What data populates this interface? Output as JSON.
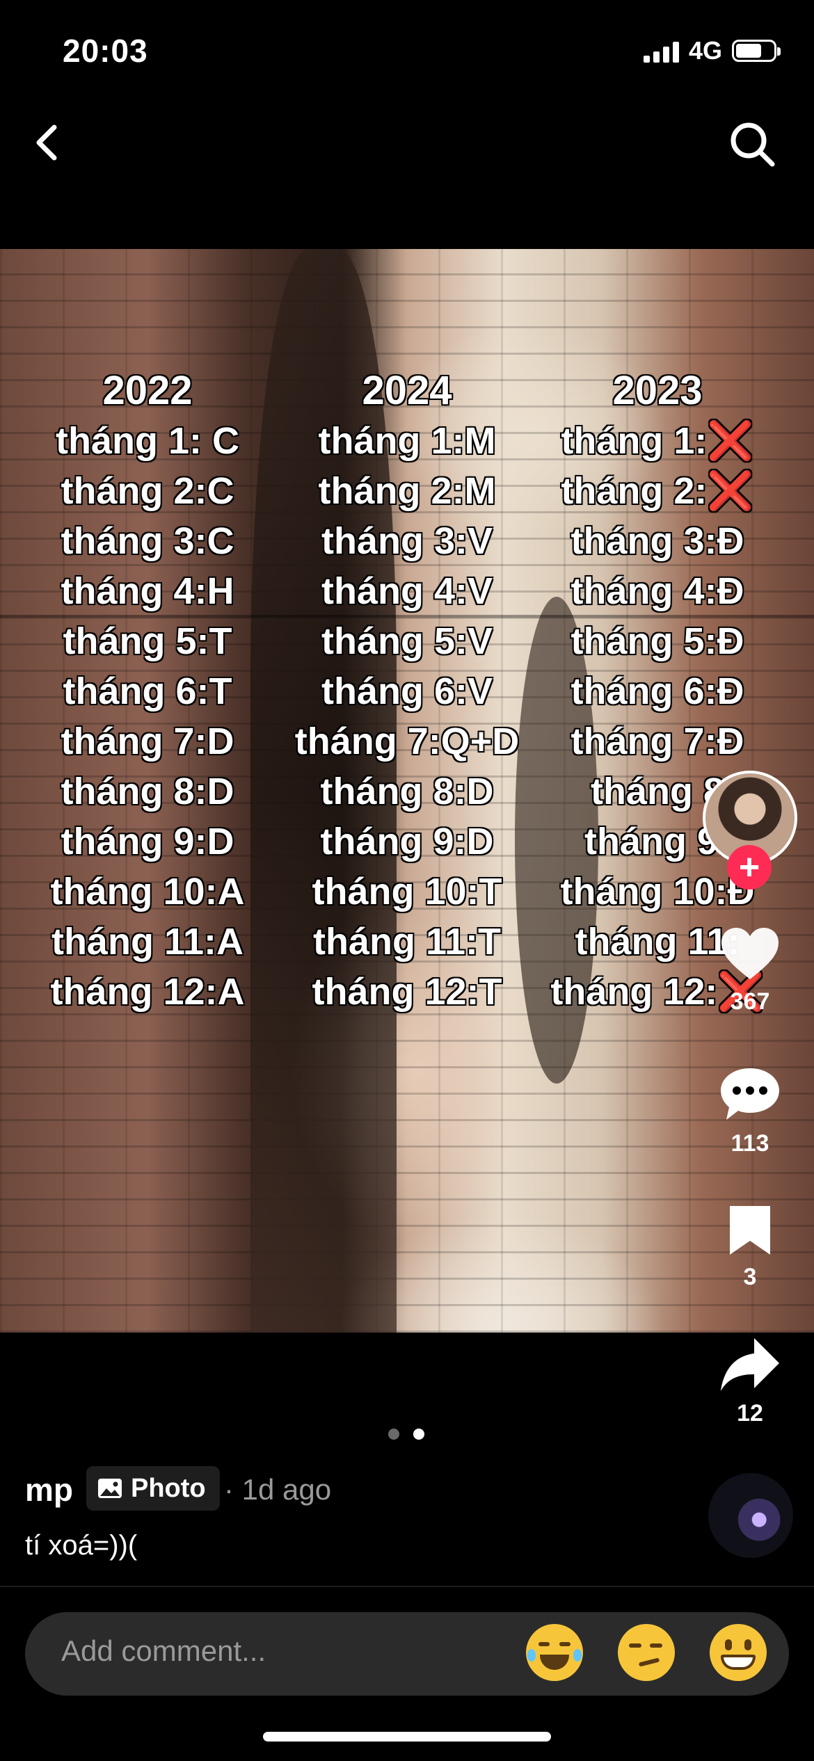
{
  "status_bar": {
    "time": "20:03",
    "network": "4G",
    "battery_level": 0.7
  },
  "nav": {
    "back_icon": "chevron-left-icon",
    "search_icon": "search-icon"
  },
  "photo": {
    "columns": [
      {
        "year": "2022",
        "months": [
          "tháng 1: C",
          "tháng 2:C",
          "tháng 3:C",
          "tháng 4:H",
          "tháng 5:T",
          "tháng 6:T",
          "tháng 7:D",
          "tháng 8:D",
          "tháng 9:D",
          "tháng 10:A",
          "tháng 11:A",
          "tháng 12:A"
        ]
      },
      {
        "year": "2024",
        "months": [
          "tháng 1:M",
          "tháng 2:M",
          "tháng 3:V",
          "tháng 4:V",
          "tháng 5:V",
          "tháng 6:V",
          "tháng 7:Q+D",
          "tháng 8:D",
          "tháng 9:D",
          "tháng 10:T",
          "tháng 11:T",
          "tháng 12:T"
        ]
      },
      {
        "year": "2023",
        "months": [
          "tháng 1:❌",
          "tháng 2:❌",
          "tháng 3:Đ",
          "tháng 4:Đ",
          "tháng 5:Đ",
          "tháng 6:Đ",
          "tháng 7:Đ",
          "tháng 8",
          "tháng 9:",
          "tháng 10:Đ",
          "tháng 11:",
          "tháng 12:❌"
        ]
      }
    ]
  },
  "actions": {
    "like_count": "367",
    "comment_count": "113",
    "save_count": "3",
    "share_count": "12",
    "follow_label": "+"
  },
  "pager": {
    "total": 2,
    "current": 2
  },
  "post": {
    "username": "mp",
    "type_badge": "Photo",
    "time_ago": "· 1d ago",
    "caption": "tí xoá=))("
  },
  "comment_bar": {
    "placeholder": "Add comment...",
    "emojis": [
      "face-with-tears-of-joy-icon",
      "smirking-face-icon",
      "grinning-face-icon"
    ]
  },
  "colors": {
    "accent": "#fe2c55",
    "bar_bg": "#2b2b2b",
    "muted": "#9a9a9a"
  }
}
